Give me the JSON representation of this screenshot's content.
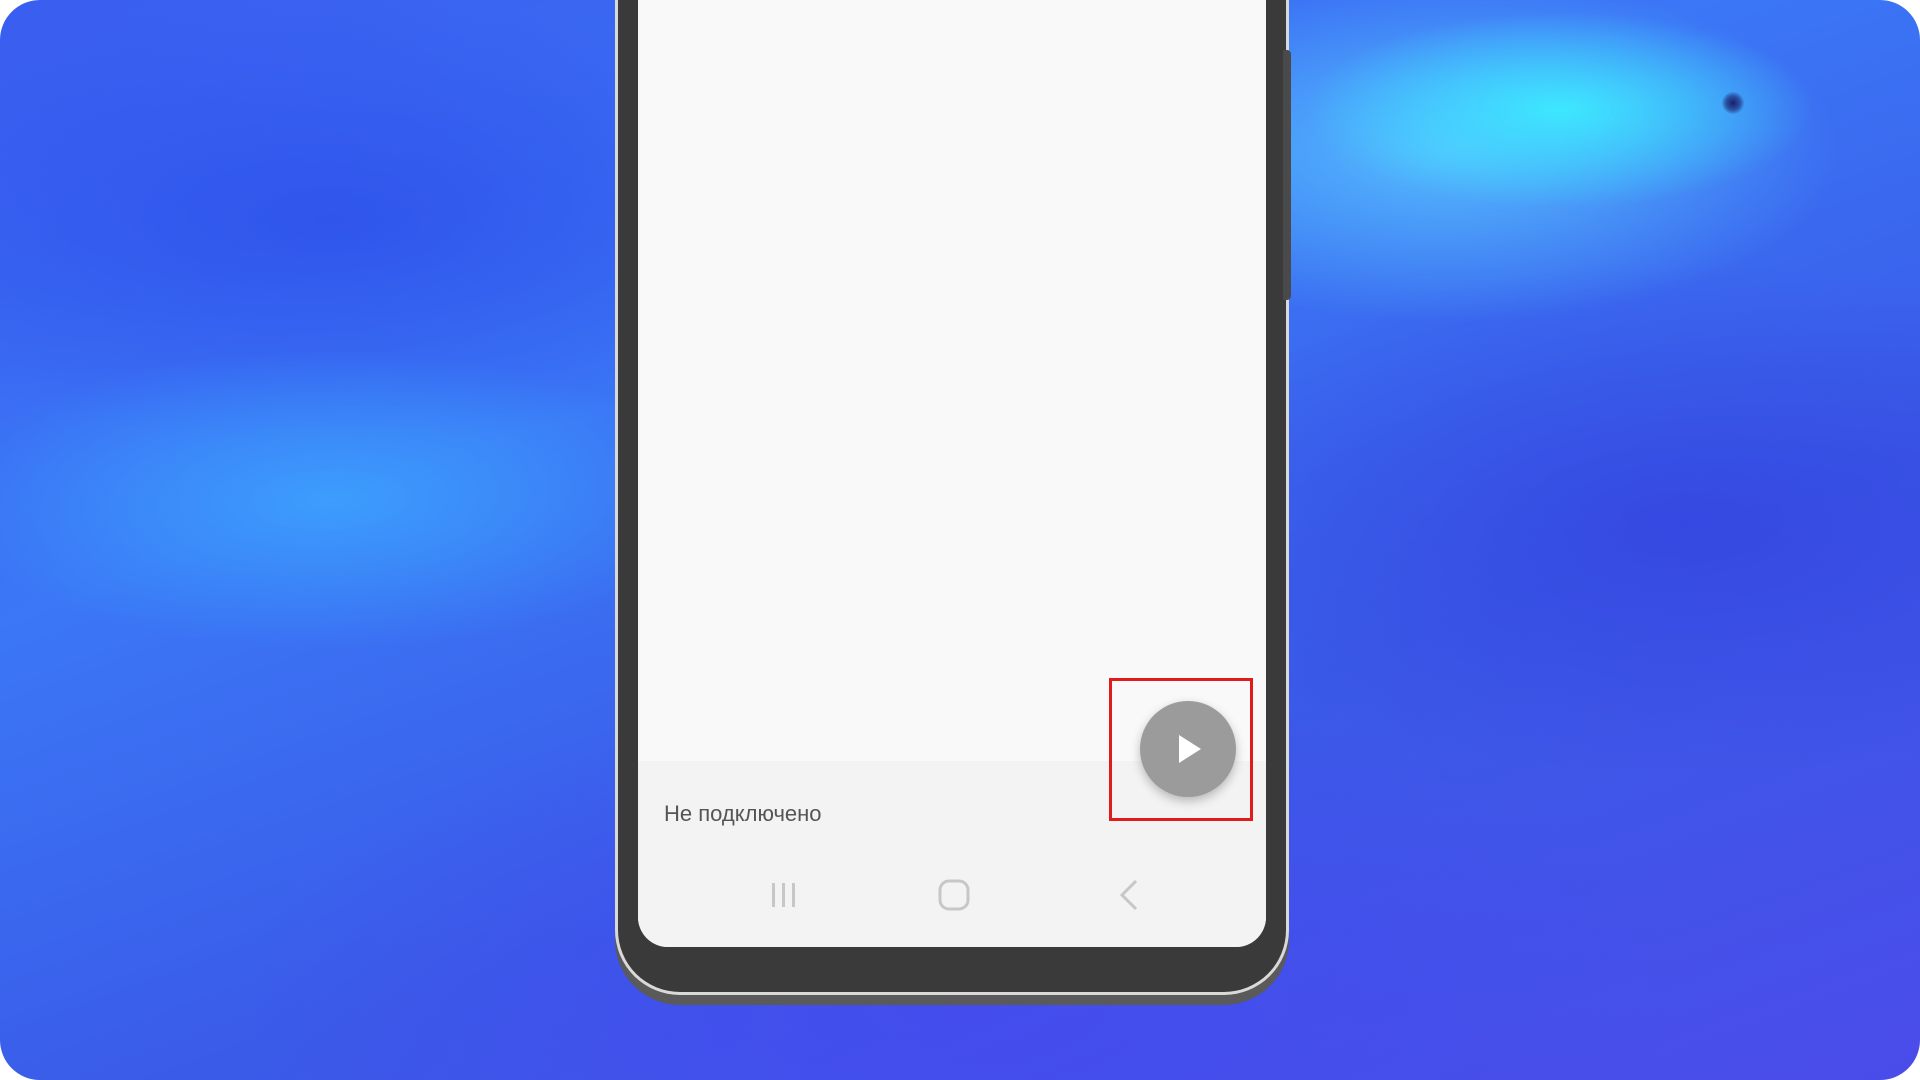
{
  "status": {
    "connection_text": "Не подключено"
  },
  "controls": {
    "play_icon": "play-icon",
    "play_color": "#9b9b9b"
  },
  "navigation": {
    "recents_icon": "recents-icon",
    "home_icon": "home-icon",
    "back_icon": "back-icon"
  },
  "highlight": {
    "color": "#e01b1b"
  }
}
